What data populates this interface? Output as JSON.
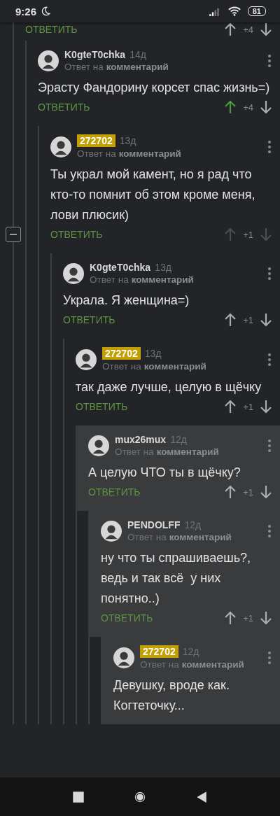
{
  "status_bar": {
    "time": "9:26",
    "battery": "81"
  },
  "thread": {
    "reply_label": "ОТВЕТИТЬ",
    "score": "+4",
    "children": [
      {
        "author": "K0gteT0chka",
        "badge": false,
        "time": "14д",
        "reply_prefix": "Ответ на",
        "reply_target": "комментарий",
        "text": "Эрасту Фандорину корсет спас жизнь=)",
        "reply_label": "ОТВЕТИТЬ",
        "score": "+4",
        "upvoted": true,
        "arrows_dimmed": false,
        "highlighted": false,
        "collapse_button": false,
        "children": [
          {
            "author": "272702",
            "badge": true,
            "time": "13д",
            "reply_prefix": "Ответ на",
            "reply_target": "комментарий",
            "text": "Ты украл мой камент, но я рад что кто-то помнит об этом кроме меня, лови плюсик)",
            "reply_label": "ОТВЕТИТЬ",
            "score": "+1",
            "upvoted": false,
            "arrows_dimmed": true,
            "highlighted": false,
            "collapse_button": true,
            "children": [
              {
                "author": "K0gteT0chka",
                "badge": false,
                "time": "13д",
                "reply_prefix": "Ответ на",
                "reply_target": "комментарий",
                "text": "Украла. Я женщина=)",
                "reply_label": "ОТВЕТИТЬ",
                "score": "+1",
                "upvoted": false,
                "arrows_dimmed": false,
                "highlighted": false,
                "collapse_button": false,
                "children": [
                  {
                    "author": "272702",
                    "badge": true,
                    "time": "13д",
                    "reply_prefix": "Ответ на",
                    "reply_target": "комментарий",
                    "text": "так даже лучше, целую в щёчку",
                    "reply_label": "ОТВЕТИТЬ",
                    "score": "+1",
                    "upvoted": false,
                    "arrows_dimmed": false,
                    "highlighted": false,
                    "collapse_button": false,
                    "children": [
                      {
                        "author": "mux26mux",
                        "badge": false,
                        "time": "12д",
                        "reply_prefix": "Ответ на",
                        "reply_target": "комментарий",
                        "text": "А целую ЧТО ты в щёчку?",
                        "reply_label": "ОТВЕТИТЬ",
                        "score": "+1",
                        "upvoted": false,
                        "arrows_dimmed": false,
                        "highlighted": true,
                        "collapse_button": false,
                        "children": [
                          {
                            "author": "PENDOLFF",
                            "badge": false,
                            "time": "12д",
                            "reply_prefix": "Ответ на",
                            "reply_target": "комментарий",
                            "text": "ну что ты спрашиваешь?, ведь и так всё  у них понятно..)",
                            "reply_label": "ОТВЕТИТЬ",
                            "score": "+1",
                            "upvoted": false,
                            "arrows_dimmed": false,
                            "highlighted": true,
                            "collapse_button": false,
                            "children": [
                              {
                                "author": "272702",
                                "badge": true,
                                "time": "12д",
                                "reply_prefix": "Ответ на",
                                "reply_target": "комментарий",
                                "text": "Девушку, вроде как. Когтеточку...",
                                "highlighted": true,
                                "collapse_button": false
                              }
                            ]
                          }
                        ]
                      }
                    ]
                  }
                ]
              }
            ]
          }
        ]
      }
    ]
  }
}
